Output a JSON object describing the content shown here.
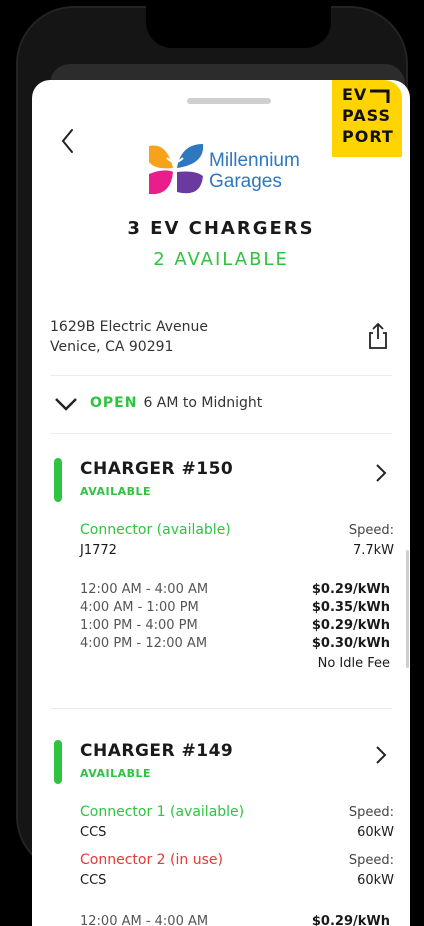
{
  "badge": {
    "line1": "EV",
    "line2": "PASS",
    "line3": "PORT"
  },
  "brand": {
    "line1": "Millennium",
    "line2": "Garages"
  },
  "header": {
    "title": "3 EV CHARGERS",
    "subtitle": "2 AVAILABLE"
  },
  "location": {
    "line1": "1629B Electric Avenue",
    "line2": "Venice, CA 90291"
  },
  "hours": {
    "status": "OPEN",
    "text": "6 AM to Midnight"
  },
  "chargers": [
    {
      "title": "CHARGER #150",
      "status": "AVAILABLE",
      "connectors": [
        {
          "label": "Connector (available)",
          "type": "J1772",
          "speed_label": "Speed:",
          "speed": "7.7kW",
          "color": "#2ec43f"
        }
      ],
      "rates": [
        {
          "time": "12:00 AM - 4:00 AM",
          "price": "$0.29/kWh"
        },
        {
          "time": "4:00 AM - 1:00 PM",
          "price": "$0.35/kWh"
        },
        {
          "time": "1:00 PM - 4:00 PM",
          "price": "$0.29/kWh"
        },
        {
          "time": "4:00 PM - 12:00 AM",
          "price": "$0.30/kWh"
        }
      ],
      "idle_fee": "No Idle Fee"
    },
    {
      "title": "CHARGER #149",
      "status": "AVAILABLE",
      "connectors": [
        {
          "label": "Connector 1 (available)",
          "type": "CCS",
          "speed_label": "Speed:",
          "speed": "60kW",
          "color": "#2ec43f"
        },
        {
          "label": "Connector 2 (in use)",
          "type": "CCS",
          "speed_label": "Speed:",
          "speed": "60kW",
          "color": "#e53935"
        }
      ],
      "rates": [
        {
          "time": "12:00 AM - 4:00 AM",
          "price": "$0.29/kWh"
        }
      ]
    }
  ],
  "icons": [
    "chevron-left-icon",
    "share-icon",
    "chevron-down-icon",
    "chevron-right-icon",
    "butterfly-logo-icon"
  ],
  "colors": {
    "available": "#2ec43f",
    "in_use": "#e53935",
    "badge": "#ffd400",
    "brand": "#2e78bf"
  }
}
